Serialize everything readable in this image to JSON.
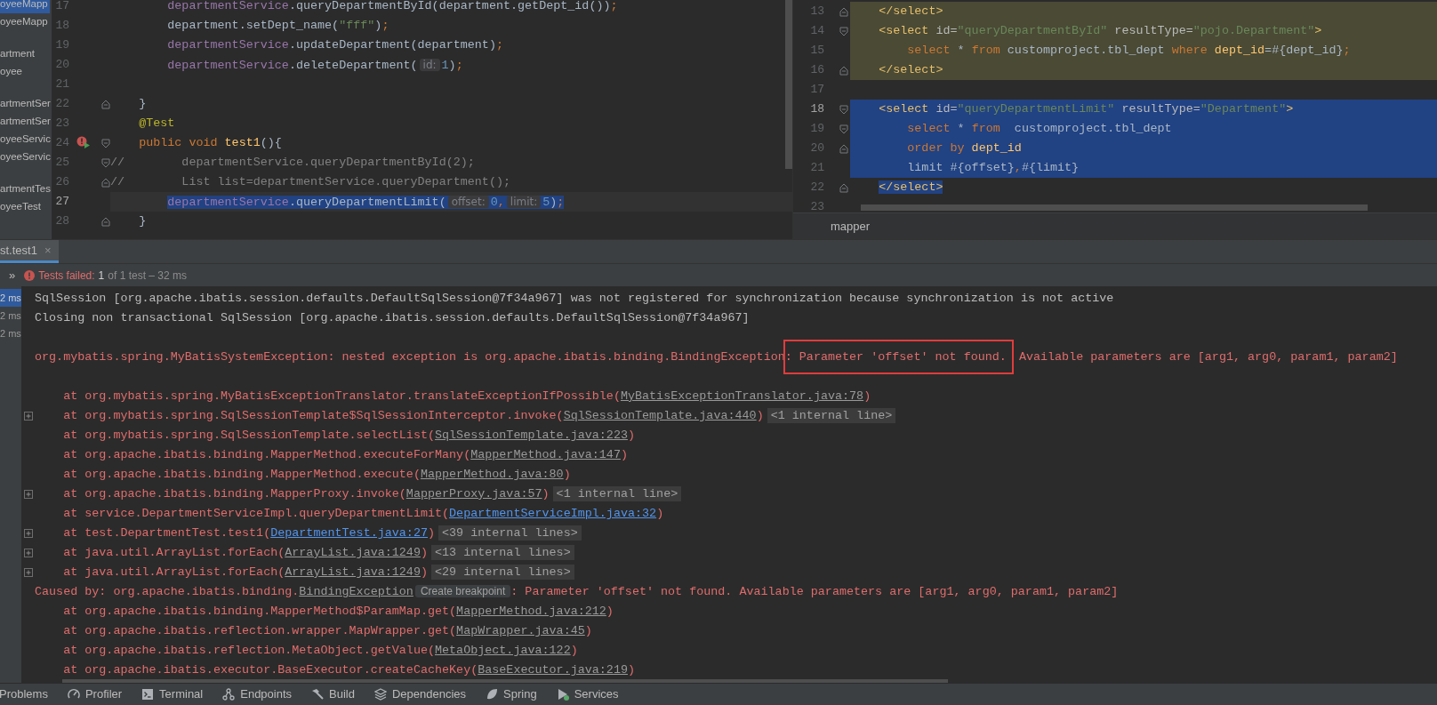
{
  "project_tree": {
    "groups": [
      {
        "items": [
          {
            "label": "oyeeMapp",
            "selected": true
          },
          {
            "label": "oyeeMapp",
            "selected": false
          }
        ]
      },
      {
        "items": [
          {
            "label": "artment",
            "selected": false
          },
          {
            "label": "oyee",
            "selected": false
          }
        ]
      },
      {
        "items": [
          {
            "label": "artmentSer",
            "selected": false
          },
          {
            "label": "artmentSer",
            "selected": false
          },
          {
            "label": "oyeeServic",
            "selected": false
          },
          {
            "label": "oyeeServic",
            "selected": false
          }
        ]
      },
      {
        "items": [
          {
            "label": "artmentTes",
            "selected": false
          },
          {
            "label": "oyeeTest",
            "selected": false
          }
        ]
      }
    ]
  },
  "editor_left": {
    "lines": [
      {
        "number": "17",
        "segments": [
          {
            "kind": "field",
            "text": "        departmentService"
          },
          {
            "kind": "plain",
            "text": ".queryDepartmentById(department.getDept_id())"
          },
          {
            "kind": "kw",
            "text": ";"
          }
        ]
      },
      {
        "number": "18",
        "segments": [
          {
            "kind": "plain",
            "text": "        department.setDept_name("
          },
          {
            "kind": "str",
            "text": "\"fff\""
          },
          {
            "kind": "plain",
            "text": ")"
          },
          {
            "kind": "kw",
            "text": ";"
          }
        ]
      },
      {
        "number": "19",
        "segments": [
          {
            "kind": "field",
            "text": "        departmentService"
          },
          {
            "kind": "plain",
            "text": ".updateDepartment(department)"
          },
          {
            "kind": "kw",
            "text": ";"
          }
        ]
      },
      {
        "number": "20",
        "segments": [
          {
            "kind": "field",
            "text": "        departmentService"
          },
          {
            "kind": "plain",
            "text": ".deleteDepartment("
          },
          {
            "kind": "hint",
            "text": "id:"
          },
          {
            "kind": "num",
            "text": "1"
          },
          {
            "kind": "plain",
            "text": ")"
          },
          {
            "kind": "kw",
            "text": ";"
          }
        ]
      },
      {
        "number": "21"
      },
      {
        "number": "22",
        "fold_end": true,
        "segments": [
          {
            "kind": "plain",
            "text": "    }"
          }
        ]
      },
      {
        "number": "23",
        "segments": [
          {
            "kind": "annot",
            "text": "    @Test"
          }
        ]
      },
      {
        "number": "24",
        "run_marker": true,
        "fold_start": true,
        "segments": [
          {
            "kind": "kw",
            "text": "    public void "
          },
          {
            "kind": "method",
            "text": "test1"
          },
          {
            "kind": "plain",
            "text": "(){"
          }
        ]
      },
      {
        "number": "25",
        "fold_start": true,
        "segments": [
          {
            "kind": "comment",
            "text": "//        departmentService.queryDepartmentById(2);"
          }
        ]
      },
      {
        "number": "26",
        "fold_end": true,
        "segments": [
          {
            "kind": "comment",
            "text": "//        List list=departmentService.queryDepartment();"
          }
        ]
      },
      {
        "number": "27",
        "current": true,
        "selected": true,
        "segments": [
          {
            "kind": "field",
            "text": "        departmentService"
          },
          {
            "kind": "plain",
            "text": ".queryDepartmentLimit("
          },
          {
            "kind": "hint",
            "text": "offset:"
          },
          {
            "kind": "num",
            "text": "0"
          },
          {
            "kind": "kw",
            "text": ","
          },
          {
            "kind": "hint",
            "text": "limit:"
          },
          {
            "kind": "num",
            "text": "5"
          },
          {
            "kind": "plain",
            "text": ")"
          },
          {
            "kind": "kw",
            "text": ";"
          }
        ]
      },
      {
        "number": "28",
        "fold_end": true,
        "segments": [
          {
            "kind": "plain",
            "text": "    }"
          }
        ]
      }
    ]
  },
  "editor_right": {
    "lines": [
      {
        "number": "13",
        "fold_end": true,
        "highlight": true,
        "segments": [
          {
            "kind": "tag",
            "text": "    </select>"
          }
        ]
      },
      {
        "number": "14",
        "fold_start": true,
        "highlight": true,
        "segments": [
          {
            "kind": "tag",
            "text": "    <select "
          },
          {
            "kind": "attr",
            "text": "id="
          },
          {
            "kind": "value",
            "text": "\"queryDepartmentById\" "
          },
          {
            "kind": "attr",
            "text": "resultType="
          },
          {
            "kind": "value",
            "text": "\"pojo.Department\""
          },
          {
            "kind": "tag",
            "text": ">"
          }
        ]
      },
      {
        "number": "15",
        "highlight": true,
        "segments": [
          {
            "kind": "kw",
            "text": "        select "
          },
          {
            "kind": "plain",
            "text": "* "
          },
          {
            "kind": "kw",
            "text": "from "
          },
          {
            "kind": "plain",
            "text": "customproject.tbl_dept "
          },
          {
            "kind": "kw",
            "text": "where "
          },
          {
            "kind": "ident",
            "text": "dept_id"
          },
          {
            "kind": "plain",
            "text": "=#{dept_id}"
          },
          {
            "kind": "kw",
            "text": ";"
          }
        ]
      },
      {
        "number": "16",
        "fold_end": true,
        "highlight": true,
        "segments": [
          {
            "kind": "tag",
            "text": "    </select>"
          }
        ]
      },
      {
        "number": "17"
      },
      {
        "number": "18",
        "current": true,
        "fold_start": true,
        "selected": true,
        "selected_to_end": true,
        "segments": [
          {
            "kind": "tag",
            "text": "    <select "
          },
          {
            "kind": "attr",
            "text": "id="
          },
          {
            "kind": "value",
            "text": "\"queryDepartmentLimit\" "
          },
          {
            "kind": "attr",
            "text": "resultType="
          },
          {
            "kind": "value",
            "text": "\"Department\""
          },
          {
            "kind": "tag",
            "text": ">"
          }
        ]
      },
      {
        "number": "19",
        "fold_start": true,
        "selected": true,
        "selected_to_end": true,
        "segments": [
          {
            "kind": "kw",
            "text": "        select "
          },
          {
            "kind": "plain",
            "text": "* "
          },
          {
            "kind": "kw",
            "text": "from "
          },
          {
            "kind": "plain",
            "text": " customproject.tbl_dept"
          }
        ]
      },
      {
        "number": "20",
        "fold_end": true,
        "selected": true,
        "selected_to_end": true,
        "segments": [
          {
            "kind": "kw",
            "text": "        order by "
          },
          {
            "kind": "ident",
            "text": "dept_id"
          }
        ]
      },
      {
        "number": "21",
        "selected": true,
        "selected_to_end": true,
        "segments": [
          {
            "kind": "plain",
            "text": "        limit #{offset}"
          },
          {
            "kind": "kw",
            "text": ","
          },
          {
            "kind": "plain",
            "text": "#{limit}"
          }
        ]
      },
      {
        "number": "22",
        "fold_end": true,
        "selected": true,
        "segments": [
          {
            "kind": "tag",
            "text": "    </select>"
          }
        ]
      },
      {
        "number": "23"
      }
    ],
    "breadcrumb": "mapper"
  },
  "run_panel": {
    "tab": {
      "label": "st.test1",
      "selected": true,
      "close": "×"
    },
    "status": {
      "more": "»",
      "label": "Tests failed:",
      "count": "1",
      "detail": "of 1 test – 32 ms"
    },
    "tests": [
      {
        "time": "2 ms",
        "selected": true
      },
      {
        "time": "2 ms",
        "selected": false
      },
      {
        "time": "2 ms",
        "selected": false
      }
    ],
    "console": [
      {
        "kind": "info",
        "segments": [
          {
            "kind": "text",
            "text": "SqlSession [org.apache.ibatis.session.defaults.DefaultSqlSession@7f34a967] was not registered for synchronization because synchronization is not active"
          }
        ]
      },
      {
        "kind": "info",
        "segments": [
          {
            "kind": "text",
            "text": "Closing non transactional SqlSession [org.apache.ibatis.session.defaults.DefaultSqlSession@7f34a967]"
          }
        ]
      },
      {
        "kind": "blank"
      },
      {
        "kind": "error",
        "segments": [
          {
            "kind": "text",
            "text": "org.mybatis.spring.MyBatisSystemException: nested exception is org.apache.ibatis.binding.BindingException"
          },
          {
            "kind": "boxed",
            "text": ": Parameter 'offset' not found."
          },
          {
            "kind": "text",
            "text": " Available parameters are [arg1, arg0, param1, param2]"
          }
        ]
      },
      {
        "kind": "blank"
      },
      {
        "kind": "trace",
        "segments": [
          {
            "kind": "text",
            "text": "    at org.mybatis.spring.MyBatisExceptionTranslator.translateExceptionIfPossible("
          },
          {
            "kind": "link",
            "text": "MyBatisExceptionTranslator.java:78"
          },
          {
            "kind": "text",
            "text": ")"
          }
        ]
      },
      {
        "kind": "trace",
        "foldable": true,
        "segments": [
          {
            "kind": "text",
            "text": "    at org.mybatis.spring.SqlSessionTemplate$SqlSessionInterceptor.invoke("
          },
          {
            "kind": "link",
            "text": "SqlSessionTemplate.java:440"
          },
          {
            "kind": "text",
            "text": ")"
          },
          {
            "kind": "note",
            "text": "<1 internal line>"
          }
        ]
      },
      {
        "kind": "trace",
        "segments": [
          {
            "kind": "text",
            "text": "    at org.mybatis.spring.SqlSessionTemplate.selectList("
          },
          {
            "kind": "link",
            "text": "SqlSessionTemplate.java:223"
          },
          {
            "kind": "text",
            "text": ")"
          }
        ]
      },
      {
        "kind": "trace",
        "segments": [
          {
            "kind": "text",
            "text": "    at org.apache.ibatis.binding.MapperMethod.executeForMany("
          },
          {
            "kind": "link",
            "text": "MapperMethod.java:147"
          },
          {
            "kind": "text",
            "text": ")"
          }
        ]
      },
      {
        "kind": "trace",
        "segments": [
          {
            "kind": "text",
            "text": "    at org.apache.ibatis.binding.MapperMethod.execute("
          },
          {
            "kind": "link",
            "text": "MapperMethod.java:80"
          },
          {
            "kind": "text",
            "text": ")"
          }
        ]
      },
      {
        "kind": "trace",
        "foldable": true,
        "segments": [
          {
            "kind": "text",
            "text": "    at org.apache.ibatis.binding.MapperProxy.invoke("
          },
          {
            "kind": "link",
            "text": "MapperProxy.java:57"
          },
          {
            "kind": "text",
            "text": ")"
          },
          {
            "kind": "note",
            "text": "<1 internal line>"
          }
        ]
      },
      {
        "kind": "trace",
        "segments": [
          {
            "kind": "text",
            "text": "    at service.DepartmentServiceImpl.queryDepartmentLimit("
          },
          {
            "kind": "source",
            "text": "DepartmentServiceImpl.java:32"
          },
          {
            "kind": "text",
            "text": ")"
          }
        ]
      },
      {
        "kind": "trace",
        "foldable": true,
        "segments": [
          {
            "kind": "text",
            "text": "    at test.DepartmentTest.test1("
          },
          {
            "kind": "source",
            "text": "DepartmentTest.java:27"
          },
          {
            "kind": "text",
            "text": ")"
          },
          {
            "kind": "note",
            "text": "<39 internal lines>"
          }
        ]
      },
      {
        "kind": "trace",
        "foldable": true,
        "segments": [
          {
            "kind": "text",
            "text": "    at java.util.ArrayList.forEach("
          },
          {
            "kind": "link",
            "text": "ArrayList.java:1249"
          },
          {
            "kind": "text",
            "text": ")"
          },
          {
            "kind": "note",
            "text": "<13 internal lines>"
          }
        ]
      },
      {
        "kind": "trace",
        "foldable": true,
        "segments": [
          {
            "kind": "text",
            "text": "    at java.util.ArrayList.forEach("
          },
          {
            "kind": "link",
            "text": "ArrayList.java:1249"
          },
          {
            "kind": "text",
            "text": ")"
          },
          {
            "kind": "note",
            "text": "<29 internal lines>"
          }
        ]
      },
      {
        "kind": "error",
        "segments": [
          {
            "kind": "text",
            "text": "Caused by: org.apache.ibatis.binding."
          },
          {
            "kind": "link",
            "text": "BindingException"
          },
          {
            "kind": "chip",
            "text": "Create breakpoint"
          },
          {
            "kind": "text",
            "text": ": Parameter 'offset' not found. Available parameters are [arg1, arg0, param1, param2]"
          }
        ]
      },
      {
        "kind": "trace",
        "segments": [
          {
            "kind": "text",
            "text": "    at org.apache.ibatis.binding.MapperMethod$ParamMap.get("
          },
          {
            "kind": "link",
            "text": "MapperMethod.java:212"
          },
          {
            "kind": "text",
            "text": ")"
          }
        ]
      },
      {
        "kind": "trace",
        "segments": [
          {
            "kind": "text",
            "text": "    at org.apache.ibatis.reflection.wrapper.MapWrapper.get("
          },
          {
            "kind": "link",
            "text": "MapWrapper.java:45"
          },
          {
            "kind": "text",
            "text": ")"
          }
        ]
      },
      {
        "kind": "trace",
        "segments": [
          {
            "kind": "text",
            "text": "    at org.apache.ibatis.reflection.MetaObject.getValue("
          },
          {
            "kind": "link",
            "text": "MetaObject.java:122"
          },
          {
            "kind": "text",
            "text": ")"
          }
        ]
      },
      {
        "kind": "trace",
        "segments": [
          {
            "kind": "text",
            "text": "    at org.apache.ibatis.executor.BaseExecutor.createCacheKey("
          },
          {
            "kind": "link",
            "text": "BaseExecutor.java:219"
          },
          {
            "kind": "text",
            "text": ")"
          }
        ]
      }
    ]
  },
  "tool_window_bar": [
    {
      "label": "Problems",
      "kind": "none"
    },
    {
      "label": "Profiler",
      "kind": "gauge"
    },
    {
      "label": "Terminal",
      "kind": "terminal"
    },
    {
      "label": "Endpoints",
      "kind": "nodes"
    },
    {
      "label": "Build",
      "kind": "hammer"
    },
    {
      "label": "Dependencies",
      "kind": "layers"
    },
    {
      "label": "Spring",
      "kind": "leaf"
    },
    {
      "label": "Services",
      "kind": "services"
    }
  ]
}
